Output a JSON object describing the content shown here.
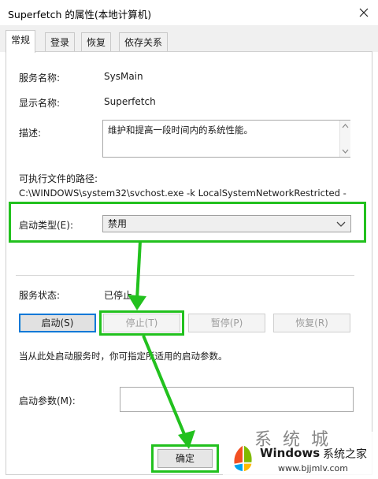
{
  "window": {
    "title": "Superfetch 的属性(本地计算机)"
  },
  "tabs": [
    {
      "label": "常规",
      "active": true
    },
    {
      "label": "登录",
      "active": false
    },
    {
      "label": "恢复",
      "active": false
    },
    {
      "label": "依存关系",
      "active": false
    }
  ],
  "general": {
    "service_name_label": "服务名称:",
    "service_name": "SysMain",
    "display_name_label": "显示名称:",
    "display_name": "Superfetch",
    "description_label": "描述:",
    "description": "维护和提高一段时间内的系统性能。",
    "path_label": "可执行文件的路径:",
    "path": "C:\\WINDOWS\\system32\\svchost.exe -k LocalSystemNetworkRestricted -",
    "startup_type_label": "启动类型(E):",
    "startup_type": "禁用",
    "status_label": "服务状态:",
    "status": "已停止",
    "buttons": {
      "start": "启动(S)",
      "stop": "停止(T)",
      "pause": "暂停(P)",
      "resume": "恢复(R)"
    },
    "hint": "当从此处启动服务时，你可指定所适用的启动参数。",
    "params_label": "启动参数(M):",
    "params_value": ""
  },
  "footer": {
    "ok": "确定"
  },
  "watermark": {
    "brand": "Windows",
    "brand_cn": "系统之家",
    "url": "www.bjjmlv.com",
    "partial_text": "系统城"
  },
  "colors": {
    "highlight": "#22c11e",
    "focus": "#0078d7"
  }
}
